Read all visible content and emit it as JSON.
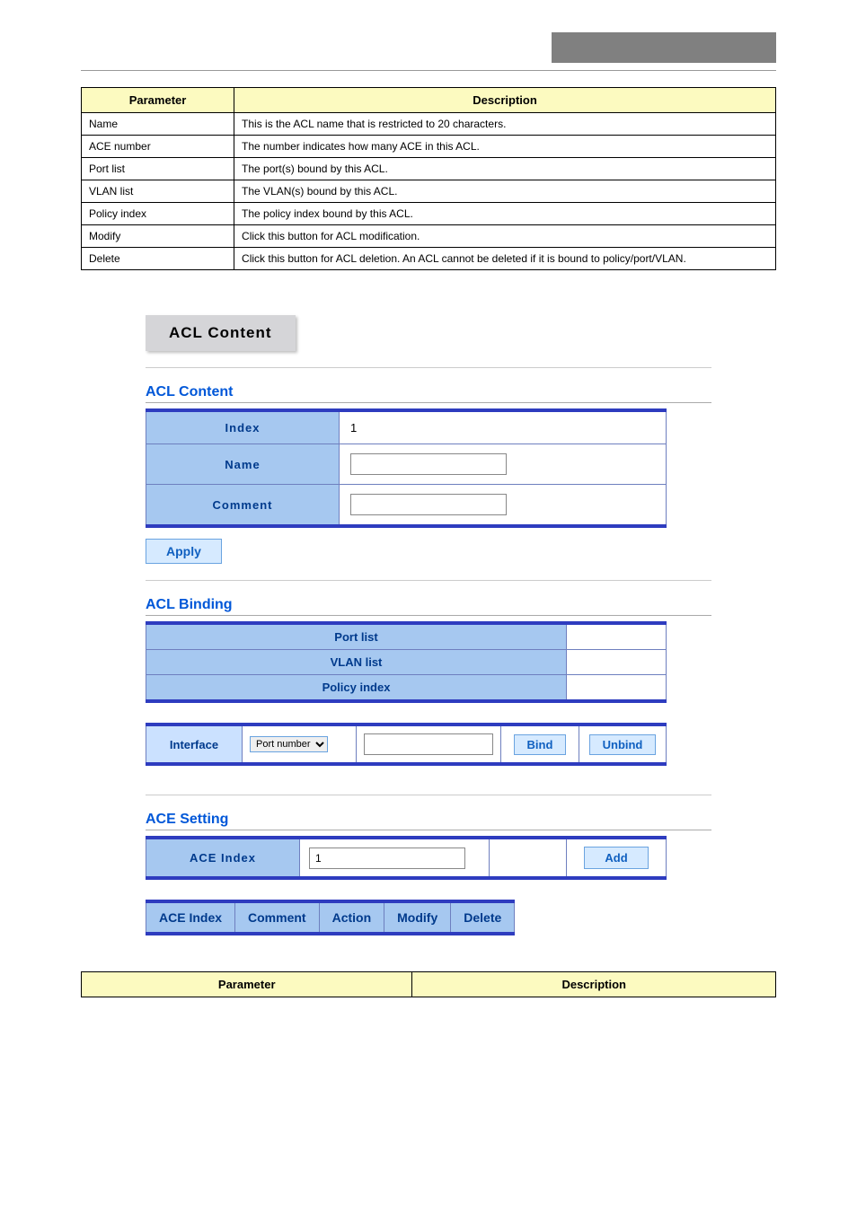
{
  "param_table": {
    "headers": [
      "Parameter",
      "Description"
    ],
    "rows": [
      [
        "Name",
        "This is the ACL name that is restricted to 20 characters."
      ],
      [
        "ACE number",
        "The number indicates how many ACE in this ACL."
      ],
      [
        "Port list",
        "The port(s) bound by this ACL."
      ],
      [
        "VLAN list",
        "The VLAN(s) bound by this ACL."
      ],
      [
        "Policy index",
        "The policy index bound by this ACL."
      ],
      [
        "Modify",
        "Click this button for ACL modification."
      ],
      [
        "Delete",
        "Click this button for ACL deletion. An ACL cannot be deleted if it is bound to policy/port/VLAN."
      ]
    ]
  },
  "tab_label": "ACL Content",
  "acl_content": {
    "title": "ACL Content",
    "rows": {
      "index_label": "Index",
      "index_value": "1",
      "name_label": "Name",
      "name_value": "",
      "comment_label": "Comment",
      "comment_value": ""
    },
    "apply_label": "Apply"
  },
  "acl_binding": {
    "title": "ACL Binding",
    "rows": {
      "portlist_label": "Port list",
      "portlist_value": "",
      "vlanlist_label": "VLAN list",
      "vlanlist_value": "",
      "policy_label": "Policy index",
      "policy_value": ""
    },
    "interface_label": "Interface",
    "select_option": "Port number",
    "bind_label": "Bind",
    "unbind_label": "Unbind"
  },
  "ace_setting": {
    "title": "ACE Setting",
    "ace_index_label": "ACE Index",
    "ace_index_value": "1",
    "add_label": "Add",
    "columns": [
      "ACE Index",
      "Comment",
      "Action",
      "Modify",
      "Delete"
    ]
  },
  "param_table2": {
    "headers": [
      "Parameter",
      "Description"
    ]
  }
}
